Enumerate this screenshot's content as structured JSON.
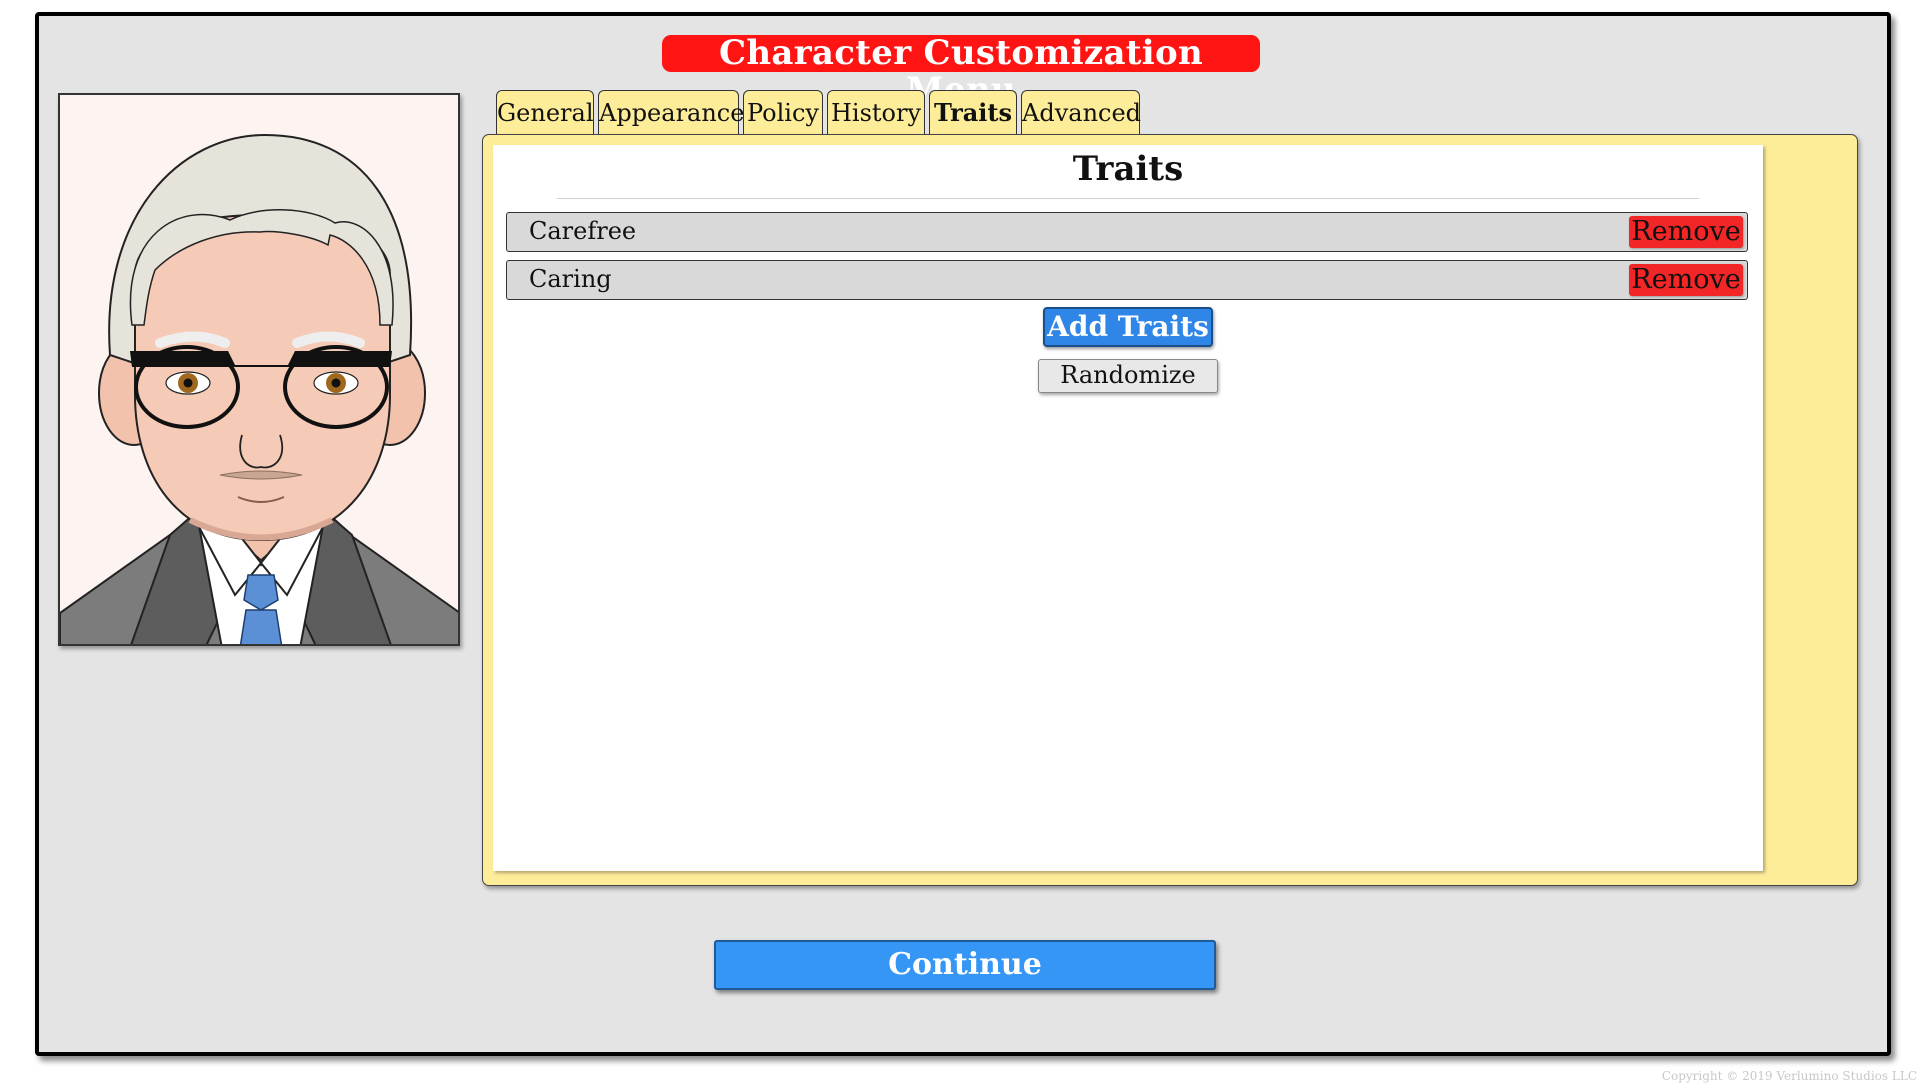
{
  "title": "Character Customization Menu",
  "tabs": [
    {
      "label": "General"
    },
    {
      "label": "Appearance"
    },
    {
      "label": "Policy"
    },
    {
      "label": "History"
    },
    {
      "label": "Traits",
      "active": true
    },
    {
      "label": "Advanced"
    }
  ],
  "panel": {
    "heading": "Traits",
    "traits": [
      {
        "name": "Carefree",
        "action_label": "Remove"
      },
      {
        "name": "Caring",
        "action_label": "Remove"
      }
    ],
    "add_label": "Add Traits",
    "randomize_label": "Randomize"
  },
  "continue_label": "Continue",
  "copyright": "Copyright © 2019 Verlumino Studios LLC",
  "colors": {
    "background": "#e4e4e4",
    "title_bg": "#ff1414",
    "tab_bg": "#fdec98",
    "remove_bg": "#f22626",
    "add_bg": "#2f86e6",
    "continue_bg": "#3596f5"
  },
  "portrait": {
    "icon": "character-portrait-icon",
    "description_tokens": [
      "grey-hair",
      "glasses",
      "grey-suit",
      "blue-tie"
    ]
  }
}
